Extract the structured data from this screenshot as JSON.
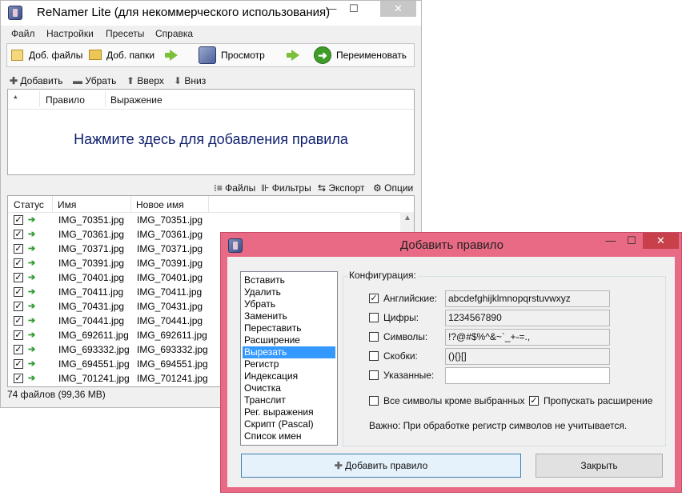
{
  "main": {
    "title": "ReNamer Lite (для некоммерческого использования)",
    "win_min": "—",
    "win_max": "☐",
    "win_close": "✕",
    "menu": [
      "Файл",
      "Настройки",
      "Пресеты",
      "Справка"
    ],
    "toolbar": {
      "add_files": "Доб. файлы",
      "add_folders": "Доб. папки",
      "preview": "Просмотр",
      "rename": "Переименовать"
    },
    "rulebar": {
      "add": "Добавить",
      "remove": "Убрать",
      "up": "Вверх",
      "down": "Вниз"
    },
    "rules_headers": {
      "num": "*",
      "rule": "Правило",
      "expr": "Выражение"
    },
    "rules_cta": "Нажмите здесь для добавления правила",
    "lowbar": {
      "files": "Файлы",
      "filters": "Фильтры",
      "export": "Экспорт",
      "options": "Опции"
    },
    "files_headers": {
      "status": "Статус",
      "name": "Имя",
      "new_name": "Новое имя"
    },
    "files": [
      {
        "name": "IMG_70351.jpg",
        "new": "IMG_70351.jpg"
      },
      {
        "name": "IMG_70361.jpg",
        "new": "IMG_70361.jpg"
      },
      {
        "name": "IMG_70371.jpg",
        "new": "IMG_70371.jpg"
      },
      {
        "name": "IMG_70391.jpg",
        "new": "IMG_70391.jpg"
      },
      {
        "name": "IMG_70401.jpg",
        "new": "IMG_70401.jpg"
      },
      {
        "name": "IMG_70411.jpg",
        "new": "IMG_70411.jpg"
      },
      {
        "name": "IMG_70431.jpg",
        "new": "IMG_70431.jpg"
      },
      {
        "name": "IMG_70441.jpg",
        "new": "IMG_70441.jpg"
      },
      {
        "name": "IMG_692611.jpg",
        "new": "IMG_692611.jpg"
      },
      {
        "name": "IMG_693332.jpg",
        "new": "IMG_693332.jpg"
      },
      {
        "name": "IMG_694551.jpg",
        "new": "IMG_694551.jpg"
      },
      {
        "name": "IMG_701241.jpg",
        "new": "IMG_701241.jpg"
      }
    ],
    "status": "74 файлов (99,36 MB)"
  },
  "dialog": {
    "title": "Добавить правило",
    "win_min": "—",
    "win_max": "☐",
    "win_close": "✕",
    "rules": [
      "Вставить",
      "Удалить",
      "Убрать",
      "Заменить",
      "Переставить",
      "Расширение",
      "Вырезать",
      "Регистр",
      "Индексация",
      "Очистка",
      "Транслит",
      "Рег. выражения",
      "Скрипт (Pascal)",
      "Список имен"
    ],
    "selected_rule": "Вырезать",
    "config_label": "Конфигурация:",
    "options": [
      {
        "label": "Английские:",
        "checked": true,
        "value": "abcdefghijklmnopqrstuvwxyz"
      },
      {
        "label": "Цифры:",
        "checked": false,
        "value": "1234567890"
      },
      {
        "label": "Символы:",
        "checked": false,
        "value": "!?@#$%^&~`_+-=.,"
      },
      {
        "label": "Скобки:",
        "checked": false,
        "value": "(){}[]"
      },
      {
        "label": "Указанные:",
        "checked": false,
        "value": ""
      }
    ],
    "all_except": {
      "label": "Все символы кроме выбранных",
      "checked": false
    },
    "skip_ext": {
      "label": "Пропускать расширение",
      "checked": true
    },
    "note": "Важно: При обработке регистр символов не учитывается.",
    "add_button": "Добавить правило",
    "close_button": "Закрыть",
    "accent_color": "#e96a85"
  }
}
